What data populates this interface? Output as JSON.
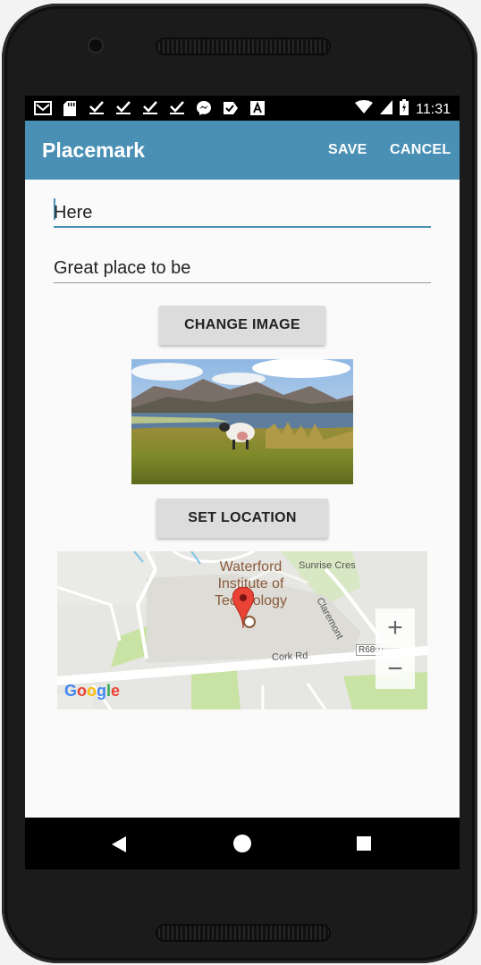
{
  "status_bar": {
    "time": "11:31",
    "icons": [
      "gmail-icon",
      "sd-card-icon",
      "check-icon",
      "check-icon",
      "check-icon",
      "check-icon",
      "messenger-icon",
      "check-flag-icon",
      "a-icon"
    ]
  },
  "app_bar": {
    "title": "Placemark",
    "save_label": "SAVE",
    "cancel_label": "CANCEL",
    "color": "#4a90b4"
  },
  "form": {
    "title_value": "Here",
    "description_value": "Great place to be",
    "change_image_label": "CHANGE IMAGE",
    "set_location_label": "SET LOCATION"
  },
  "map": {
    "place_lines": [
      "Waterford",
      "Institute of",
      "Technology"
    ],
    "street_sunrise": "Sunrise Cres",
    "street_claremont": "Claremont",
    "street_cork": "Cork Rd",
    "road_badge": "R680",
    "zoom_in": "+",
    "zoom_out": "−",
    "logo": "Google"
  }
}
